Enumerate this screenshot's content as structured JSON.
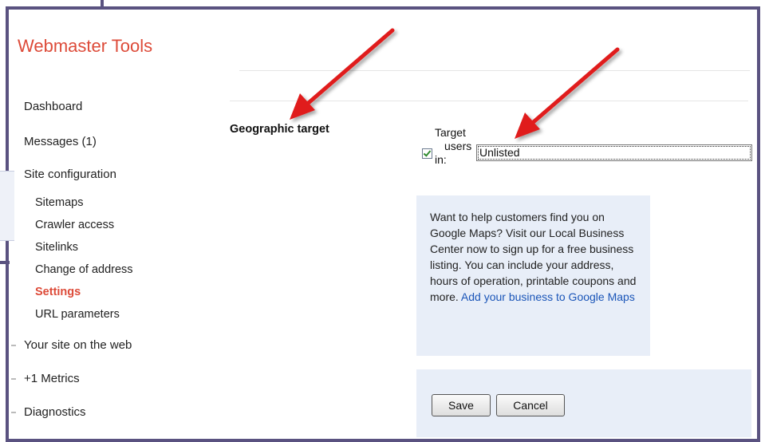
{
  "app": {
    "title": "Webmaster Tools"
  },
  "sidebar": {
    "items": [
      {
        "label": "Dashboard"
      },
      {
        "label": "Messages (1)"
      },
      {
        "label": "Site configuration"
      }
    ],
    "subitems": [
      {
        "label": "Sitemaps"
      },
      {
        "label": "Crawler access"
      },
      {
        "label": "Sitelinks"
      },
      {
        "label": "Change of address"
      },
      {
        "label": "Settings",
        "active": true
      },
      {
        "label": "URL parameters"
      }
    ],
    "more_items": [
      {
        "label": "Your site on the web"
      },
      {
        "label": "+1 Metrics"
      },
      {
        "label": "Diagnostics"
      }
    ]
  },
  "settings": {
    "section_label": "Geographic target",
    "target_label_lines": [
      "Target",
      "users",
      "in:"
    ],
    "target_checked": true,
    "target_value": "Unlisted"
  },
  "info": {
    "text": "Want to help customers find you on Google Maps? Visit our Local Business Center now to sign up for a free business listing. You can include your address, hours of operation, printable coupons and more.",
    "link_text": "Add your business to Google Maps"
  },
  "actions": {
    "save_label": "Save",
    "cancel_label": "Cancel"
  },
  "colors": {
    "brand": "#dd4b39",
    "link": "#1a55b8",
    "panel": "#e8eef8",
    "arrow": "#e01f1f",
    "frame": "#5a5280"
  }
}
